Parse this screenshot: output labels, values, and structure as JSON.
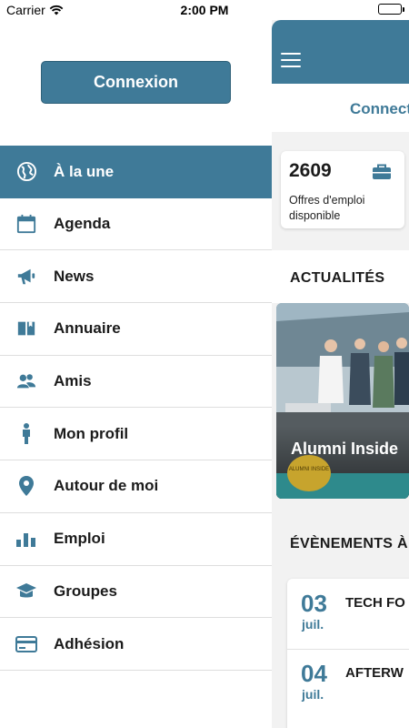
{
  "status_bar": {
    "carrier": "Carrier",
    "time": "2:00 PM"
  },
  "drawer": {
    "login_button": "Connexion",
    "menu": [
      {
        "label": "À la une",
        "icon": "globe-icon",
        "active": true
      },
      {
        "label": "Agenda",
        "icon": "calendar-icon"
      },
      {
        "label": "News",
        "icon": "megaphone-icon"
      },
      {
        "label": "Annuaire",
        "icon": "book-icon"
      },
      {
        "label": "Amis",
        "icon": "users-icon"
      },
      {
        "label": "Mon profil",
        "icon": "person-icon"
      },
      {
        "label": "Autour de moi",
        "icon": "map-pin-icon"
      },
      {
        "label": "Emploi",
        "icon": "bar-chart-icon"
      },
      {
        "label": "Groupes",
        "icon": "graduation-cap-icon"
      },
      {
        "label": "Adhésion",
        "icon": "credit-card-icon"
      }
    ]
  },
  "main": {
    "connect_text": "Connect",
    "jobs": {
      "count": "2609",
      "description": "Offres d'emploi disponible"
    },
    "news_section_title": "ACTUALITÉS",
    "news_card": {
      "caption": "Alumni Inside",
      "badge": "ALUMNI INSIDE"
    },
    "events_section_title": "ÉVÈNEMENTS À",
    "events": [
      {
        "day": "03",
        "month": "juil.",
        "title": "TECH FO"
      },
      {
        "day": "04",
        "month": "juil.",
        "title": "AFTERW"
      }
    ]
  },
  "colors": {
    "accent": "#3f7a98",
    "background": "#f2f2f2"
  }
}
